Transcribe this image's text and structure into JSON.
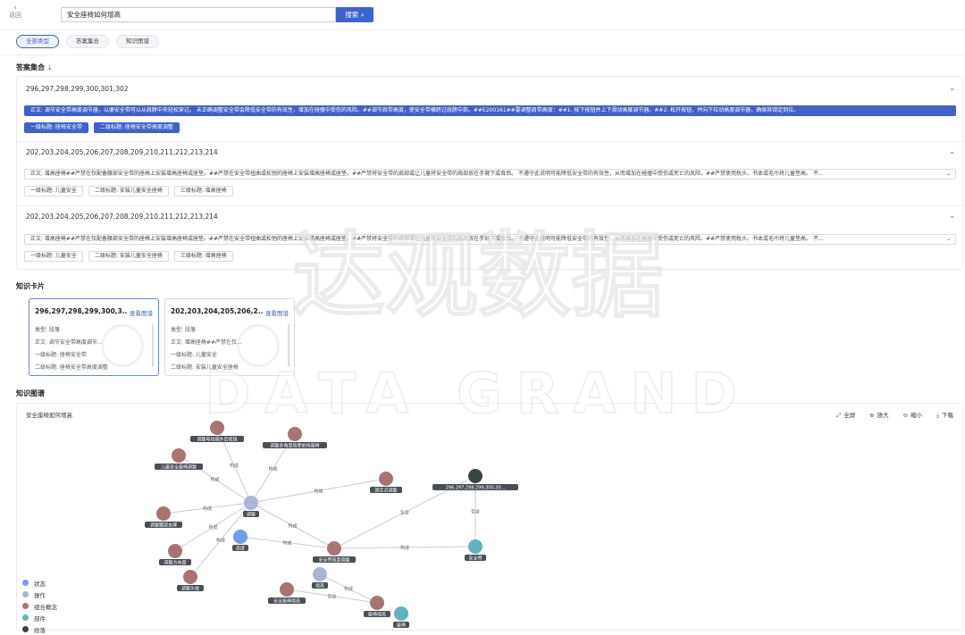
{
  "back": {
    "label": "返回"
  },
  "search": {
    "value": "安全座椅如何增高",
    "button": "搜索"
  },
  "tabs": [
    {
      "label": "全部类型",
      "active": true
    },
    {
      "label": "答案集合",
      "active": false
    },
    {
      "label": "知识图谱",
      "active": false
    }
  ],
  "answers": {
    "title": "答案集合",
    "groups": [
      {
        "ids": "296,297,298,299,300,301,302",
        "passage": "正文: 调节安全带高度调节器，以便安全带可以从肩膀中央轻松穿过。 未正确调整安全带会降低安全带的有效性，增加在碰撞中受伤的风险。##调节肩带高度，使安全带横跨过肩膀中部。##E200161##要调整肩带高度：##1. 按下按钮并上下滑动高度调节器。##2. 松开按钮，并向下拉动高度调节器，确保其锁定到位。",
        "highlight": true,
        "tags": [
          "一级标题: 座椅安全带",
          "二级标题: 座椅安全带高度调整"
        ]
      },
      {
        "ids": "202,203,204,205,206,207,208,209,210,211,212,213,214",
        "passage": "正文: 增高座椅##严禁在仅配备腰部安全带的座椅上安装增高座椅或座垫。##严禁在安全带扭曲或松弛的座椅上安装增高座椅或座垫。##严禁将安全带的肩部或让儿童将安全带的肩部放在手臂下或背后。 不遵守此说明可能降低安全带的有效性，从而增加在碰撞中受伤或死亡的风险。##严禁使用枕头、书本或毛巾将儿童垫高。 不...",
        "highlight": false,
        "tags": [
          "一级标题: 儿童安全",
          "二级标题: 安装儿童安全座椅",
          "三级标题: 增高座椅"
        ]
      },
      {
        "ids": "202,203,204,205,206,207,208,209,210,211,212,213,214",
        "passage": "正文: 增高座椅##严禁在仅配备腰部安全带的座椅上安装增高座椅或座垫。##严禁在安全带扭曲或松弛的座椅上安装增高座椅或座垫。##严禁将安全带的肩部或让儿童将安全带的肩部放在手臂下或背后。 不遵守此说明可能降低安全带的有效性，从而增加在碰撞中受伤或死亡的风险。##严禁使用枕头、书本或毛巾将儿童垫高。 不...",
        "highlight": false,
        "tags": [
          "一级标题: 儿童安全",
          "二级标题: 安装儿童安全座椅",
          "三级标题: 增高座椅"
        ]
      }
    ]
  },
  "cards": {
    "title": "知识卡片",
    "link": "查看图谱",
    "items": [
      {
        "title": "296,297,298,299,300,3...",
        "type": "类型:  段落",
        "body": "正文:  调节安全带高度调节...",
        "h1": "一级标题:  座椅安全带",
        "h2": "二级标题:  座椅安全带高度调整"
      },
      {
        "title": "202,203,204,205,206,2...",
        "type": "类型:  段落",
        "body": "正文:  增高座椅##严禁在仅...",
        "h1": "一级标题:  儿童安全",
        "h2": "二级标题:  安装儿童安全座椅"
      }
    ]
  },
  "graph": {
    "section_title": "知识图谱",
    "title": "安全座椅如何增高",
    "tools": [
      "全屏",
      "放大",
      "缩小",
      "下载"
    ],
    "legend": [
      {
        "label": "状态",
        "color": "#6d9ef0"
      },
      {
        "label": "操作",
        "color": "#aab5d8"
      },
      {
        "label": "组合概念",
        "color": "#a87472"
      },
      {
        "label": "部件",
        "color": "#5fb4bd"
      },
      {
        "label": "段落",
        "color": "#3a4545"
      }
    ],
    "nodes": {
      "tiaozhengdiandongzuoyi": "调整电动座外后视镜",
      "tiaozhenggaodu": "调整多角度按摩前排座椅",
      "ertong": "儿童安全座椅调整",
      "gudingdian": "固定点调整",
      "para": "296,297,298,299,300,30...",
      "tiaozheng": "调整",
      "yaobu": "调整腰部支撑",
      "gaodu": "高度",
      "anquandai_gaodu": "安全带高度调整",
      "anquandai": "安全带",
      "fangxiangpan": "调整方向盘",
      "toubu": "调整头枕",
      "zenggao": "增高",
      "anquanzuoyi": "安全座椅增高",
      "zuoyi_zenggao": "座椅增高",
      "zuoyi": "座椅"
    },
    "edges": {
      "goucheng": "构成",
      "baohan": "包含"
    }
  },
  "watermark": {
    "cn": "达观数据",
    "en": "DATA GRAND"
  }
}
